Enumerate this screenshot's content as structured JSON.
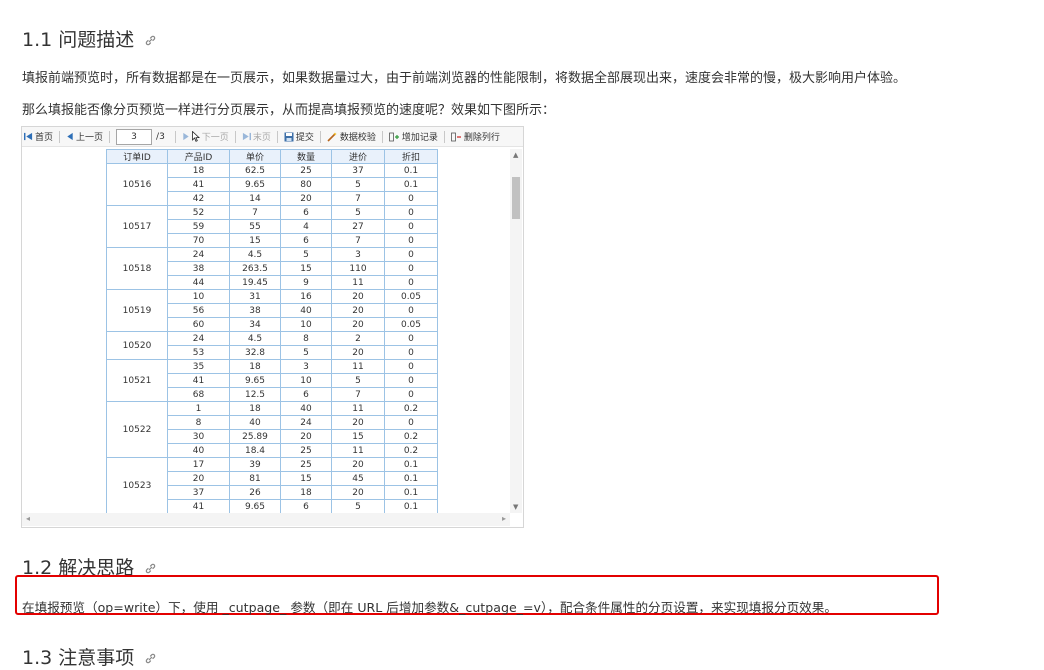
{
  "section1": {
    "title": "1.1 问题描述",
    "para1": "填报前端预览时，所有数据都是在一页展示，如果数据量过大，由于前端浏览器的性能限制，将数据全部展现出来，速度会非常的慢，极大影响用户体验。",
    "para2": "那么填报能否像分页预览一样进行分页展示，从而提高填报预览的速度呢？效果如下图所示："
  },
  "toolbar": {
    "first": "首页",
    "prev": "上一页",
    "page_value": "3",
    "page_total": "/3",
    "next": "下一页",
    "last": "末页",
    "submit": "提交",
    "verify": "数据校验",
    "add_record": "增加记录",
    "delete_row": "删除列行"
  },
  "table": {
    "headers": [
      "订单ID",
      "产品ID",
      "单价",
      "数量",
      "进价",
      "折扣"
    ],
    "groups": [
      {
        "order": "10516",
        "rows": [
          [
            "18",
            "62.5",
            "25",
            "37",
            "0.1"
          ],
          [
            "41",
            "9.65",
            "80",
            "5",
            "0.1"
          ],
          [
            "42",
            "14",
            "20",
            "7",
            "0"
          ]
        ]
      },
      {
        "order": "10517",
        "rows": [
          [
            "52",
            "7",
            "6",
            "5",
            "0"
          ],
          [
            "59",
            "55",
            "4",
            "27",
            "0"
          ],
          [
            "70",
            "15",
            "6",
            "7",
            "0"
          ]
        ]
      },
      {
        "order": "10518",
        "rows": [
          [
            "24",
            "4.5",
            "5",
            "3",
            "0"
          ],
          [
            "38",
            "263.5",
            "15",
            "110",
            "0"
          ],
          [
            "44",
            "19.45",
            "9",
            "11",
            "0"
          ]
        ]
      },
      {
        "order": "10519",
        "rows": [
          [
            "10",
            "31",
            "16",
            "20",
            "0.05"
          ],
          [
            "56",
            "38",
            "40",
            "20",
            "0"
          ],
          [
            "60",
            "34",
            "10",
            "20",
            "0.05"
          ]
        ]
      },
      {
        "order": "10520",
        "rows": [
          [
            "24",
            "4.5",
            "8",
            "2",
            "0"
          ],
          [
            "53",
            "32.8",
            "5",
            "20",
            "0"
          ]
        ]
      },
      {
        "order": "10521",
        "rows": [
          [
            "35",
            "18",
            "3",
            "11",
            "0"
          ],
          [
            "41",
            "9.65",
            "10",
            "5",
            "0"
          ],
          [
            "68",
            "12.5",
            "6",
            "7",
            "0"
          ]
        ]
      },
      {
        "order": "10522",
        "rows": [
          [
            "1",
            "18",
            "40",
            "11",
            "0.2"
          ],
          [
            "8",
            "40",
            "24",
            "20",
            "0"
          ],
          [
            "30",
            "25.89",
            "20",
            "15",
            "0.2"
          ],
          [
            "40",
            "18.4",
            "25",
            "11",
            "0.2"
          ]
        ]
      },
      {
        "order": "10523",
        "rows": [
          [
            "17",
            "39",
            "25",
            "20",
            "0.1"
          ],
          [
            "20",
            "81",
            "15",
            "45",
            "0.1"
          ],
          [
            "37",
            "26",
            "18",
            "20",
            "0.1"
          ],
          [
            "41",
            "9.65",
            "6",
            "5",
            "0.1"
          ]
        ]
      }
    ]
  },
  "section2": {
    "title": "1.2 解决思路",
    "para": "在填报预览（op=write）下，使用 _cutpage_ 参数（即在 URL 后增加参数&_cutpage_=v），配合条件属性的分页设置，来实现填报分页效果。"
  },
  "section3": {
    "title": "1.3 注意事项"
  },
  "colors": {
    "highlight": "#e30000",
    "grid_border": "#9cc3e5",
    "header_bg": "#e9f1fb"
  }
}
